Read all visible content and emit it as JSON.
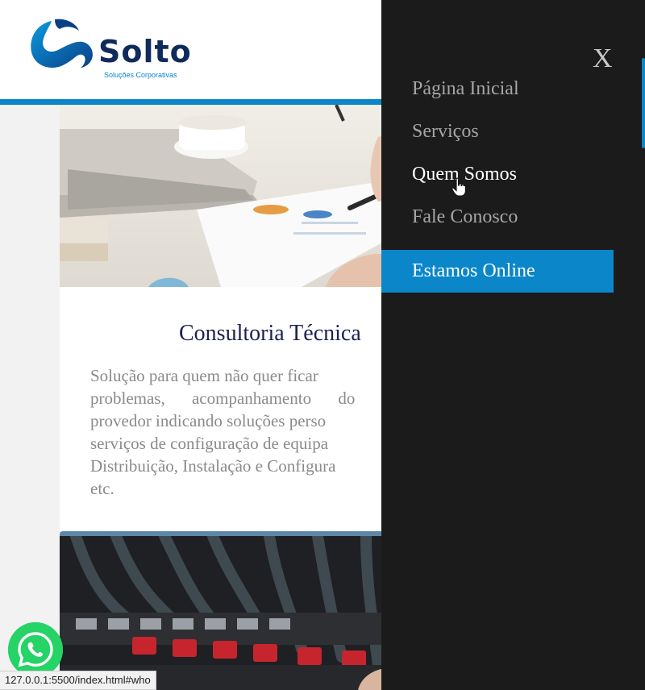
{
  "brand": {
    "name": "Solto",
    "tagline": "Soluções Corporativas"
  },
  "colors": {
    "accent": "#0a86c9",
    "menu_background": "#1b1b1b",
    "title": "#1b2150",
    "text": "#8a8a8a"
  },
  "card": {
    "title": "Consultoria Técnica",
    "text_lines": [
      "Solução para quem não quer ficar",
      "problemas, acompanhamento do",
      "provedor indicando soluções perso",
      "serviços de configuração de equipa",
      "Distribuição, Instalação e Configura",
      "etc."
    ]
  },
  "side_menu": {
    "close_label": "X",
    "items": [
      {
        "label": "Página Inicial",
        "active": false
      },
      {
        "label": "Serviços",
        "active": false
      },
      {
        "label": "Quem Somos",
        "active": true
      },
      {
        "label": "Fale Conosco",
        "active": false
      }
    ],
    "online_button_label": "Estamos Online"
  },
  "icons": {
    "logo": "solto-logo-icon",
    "whatsapp": "whatsapp-icon",
    "cursor": "hand-pointer-icon"
  },
  "status_bar": {
    "url": "127.0.0.1:5500/index.html#who"
  }
}
